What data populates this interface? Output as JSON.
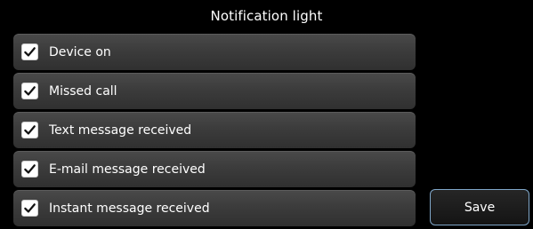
{
  "header": {
    "title": "Notification light"
  },
  "options": [
    {
      "label": "Device on",
      "checked": true
    },
    {
      "label": "Missed call",
      "checked": true
    },
    {
      "label": "Text message received",
      "checked": true
    },
    {
      "label": "E-mail message received",
      "checked": true
    },
    {
      "label": "Instant message received",
      "checked": true
    }
  ],
  "actions": {
    "save_label": "Save"
  },
  "colors": {
    "background": "#000000",
    "item_background": "#3c3c3c",
    "button_border": "#7fa6c8",
    "text": "#ffffff"
  },
  "icons": {
    "checkbox": "checkmark-icon"
  }
}
